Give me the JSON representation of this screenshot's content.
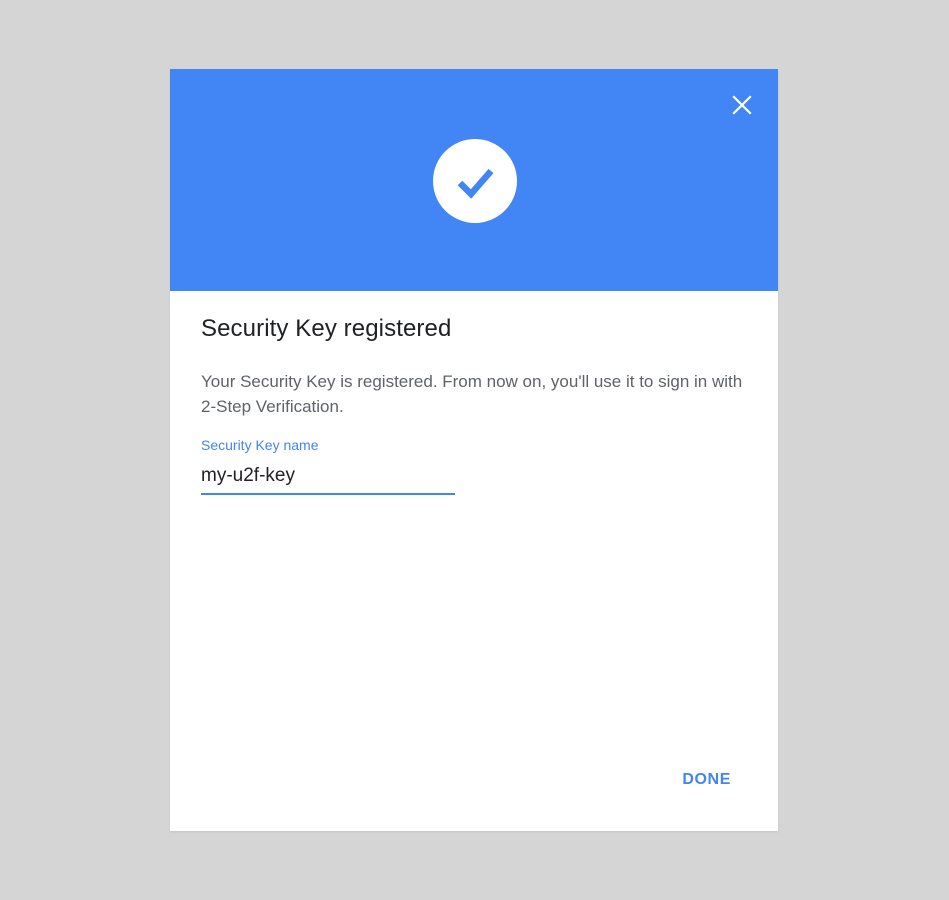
{
  "dialog": {
    "close_icon": "close-icon",
    "check_icon": "check-circle-icon",
    "title": "Security Key registered",
    "description": "Your Security Key is registered. From now on, you'll use it to sign in with 2-Step Verification.",
    "field": {
      "label": "Security Key name",
      "value": "my-u2f-key"
    },
    "done_label": "DONE"
  },
  "colors": {
    "accent": "#4285f4",
    "backdrop": "#d5d5d5",
    "title_text": "#202124",
    "body_text": "#5f6368"
  }
}
